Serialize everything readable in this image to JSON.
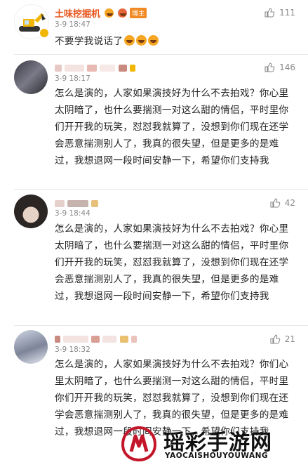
{
  "comments": [
    {
      "user": "土味挖掘机",
      "badge": "博主",
      "time": "3-9 18:47",
      "likes": "111",
      "text": "不要学我说话了"
    },
    {
      "user": "",
      "time": "3-9 18:17",
      "likes": "146",
      "text": "怎么是演的，人家如果演技好为什么不去拍戏？你心里太阴暗了，也什么要揣测一对这么甜的情侣，平时里你们开开我的玩笑，怼怼我就算了，没想到你们现在还学会恶意揣测别人了，我真的很失望，但是更多的是难过，我想退网一段时间安静一下，希望你们支持我"
    },
    {
      "user": "",
      "time": "3-9 18:44",
      "likes": "42",
      "text": "怎么是演的，人家如果演技好为什么不去拍戏？你心里太阴暗了，也什么要揣测一对这么甜的情侣，平时里你们开开我的玩笑，怼怼我就算了，没想到你们现在还学会恶意揣测别人了，我真的很失望，但是更多的是难过，我想退网一段时间安静一下，希望你们支持我"
    },
    {
      "user": "",
      "time": "3-9 18:32",
      "likes": "21",
      "text": "怎么是演的，人家如果演技好为什么不去拍戏？你们心里太阴暗了，也什么要揣测一对这么甜的情侣，平时里你们开开我的玩笑，怼怼我就算了，没想到你们现在还学会恶意揣测别人了，我真的很失望，但是更多的是难过，我想退网一段时间安静一下，希望你们支持我"
    }
  ],
  "watermark": {
    "title": "瑶彩手游网",
    "subtitle": "YAOCAISHOUYOUWANG"
  },
  "colors": {
    "username_red": "#e8541a",
    "meta_gray": "#8a8a8a",
    "badge_orange": "#f08a24"
  }
}
